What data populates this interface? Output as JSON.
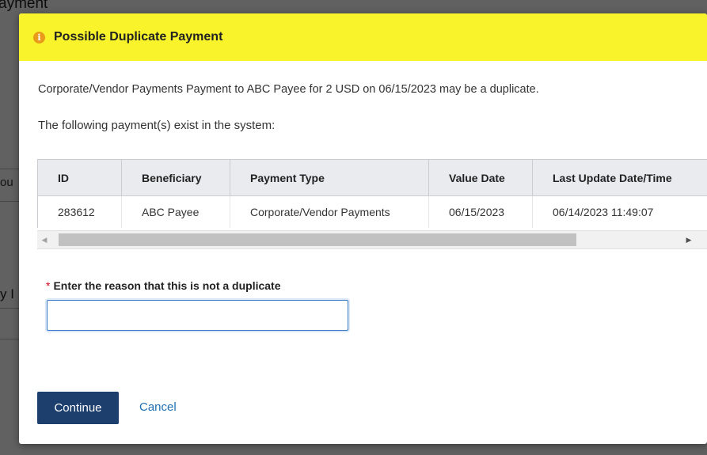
{
  "background": {
    "title_fragment": "ayment",
    "fragment_1": "ou",
    "fragment_2": "y I"
  },
  "modal": {
    "title": "Possible Duplicate Payment",
    "header_color": "#f8f32b",
    "icon": "info-warning-icon",
    "message": "Corporate/Vendor Payments Payment to ABC Payee for 2 USD on 06/15/2023 may be a duplicate.",
    "sub_message": "The following payment(s) exist in the system:",
    "table": {
      "columns": [
        "ID",
        "Beneficiary",
        "Payment Type",
        "Value Date",
        "Last Update Date/Time"
      ],
      "rows": [
        [
          "283612",
          "ABC Payee",
          "Corporate/Vendor Payments",
          "06/15/2023",
          "06/14/2023 11:49:07"
        ]
      ]
    },
    "reason": {
      "required_marker": "*",
      "label": "Enter the reason that this is not a duplicate",
      "value": "",
      "placeholder": ""
    },
    "buttons": {
      "continue": "Continue",
      "cancel": "Cancel"
    }
  }
}
